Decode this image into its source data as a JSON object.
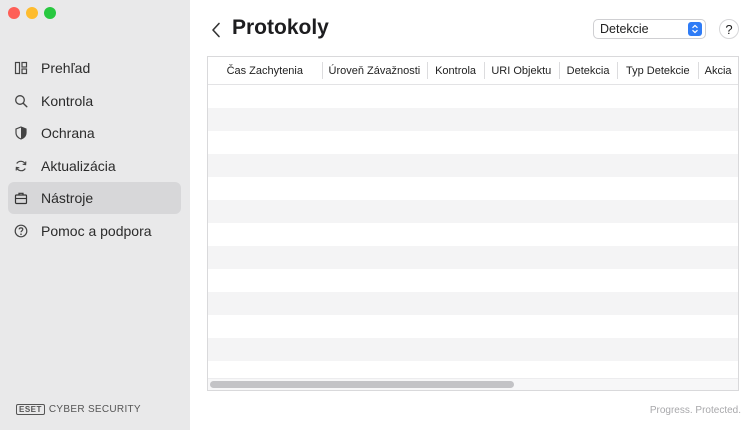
{
  "window": {
    "traffic_lights": {
      "close": "#fe5f57",
      "minimize": "#febc2e",
      "zoom": "#28c840"
    }
  },
  "sidebar": {
    "items": [
      {
        "label": "Prehľad",
        "icon": "overview-icon",
        "active": false
      },
      {
        "label": "Kontrola",
        "icon": "search-icon",
        "active": false
      },
      {
        "label": "Ochrana",
        "icon": "shield-icon",
        "active": false
      },
      {
        "label": "Aktualizácia",
        "icon": "refresh-icon",
        "active": false
      },
      {
        "label": "Nástroje",
        "icon": "briefcase-icon",
        "active": true
      },
      {
        "label": "Pomoc a podpora",
        "icon": "help-circle-icon",
        "active": false
      }
    ],
    "brand": {
      "logo": "ESET",
      "label": "CYBER SECURITY"
    }
  },
  "header": {
    "back_icon": "chevron-left-icon",
    "title": "Protokoly",
    "select": {
      "value": "Detekcie",
      "accent": "#2f7cf6"
    },
    "help_label": "?"
  },
  "table": {
    "columns": [
      "Čas Zachytenia",
      "Úroveň Závažnosti",
      "Kontrola",
      "URI Objektu",
      "Detekcia",
      "Typ Detekcie",
      "Akcia"
    ],
    "rows": []
  },
  "footer": {
    "tagline": "Progress. Protected."
  }
}
